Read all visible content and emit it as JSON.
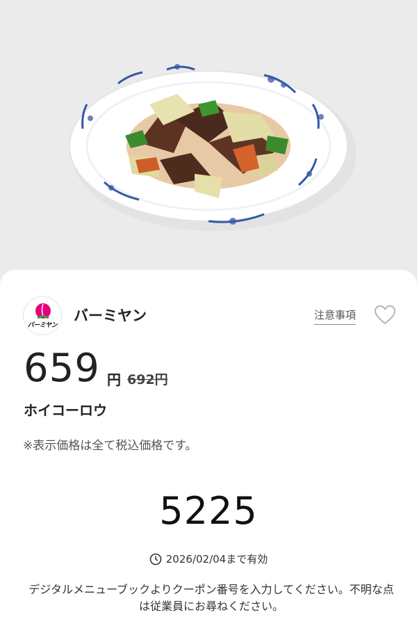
{
  "brand": {
    "name": "バーミヤン",
    "logo_text": "バーミヤン",
    "accent": "#e6007e"
  },
  "header": {
    "notes_link": "注意事項",
    "favorite_icon": "heart-outline-icon"
  },
  "offer": {
    "price": "659",
    "currency": "円",
    "original_price": "692円",
    "item_name": "ホイコーロウ",
    "tax_note": "※表示価格は全て税込価格です。"
  },
  "coupon": {
    "code": "5225",
    "expiry": "2026/02/04まで有効",
    "expiry_icon": "clock-icon",
    "instructions": "デジタルメニューブックよりクーポン番号を入力してください。不明な点は従業員にお尋ねください。"
  },
  "colors": {
    "background": "#ebebeb",
    "card": "#ffffff",
    "text": "#222222"
  }
}
